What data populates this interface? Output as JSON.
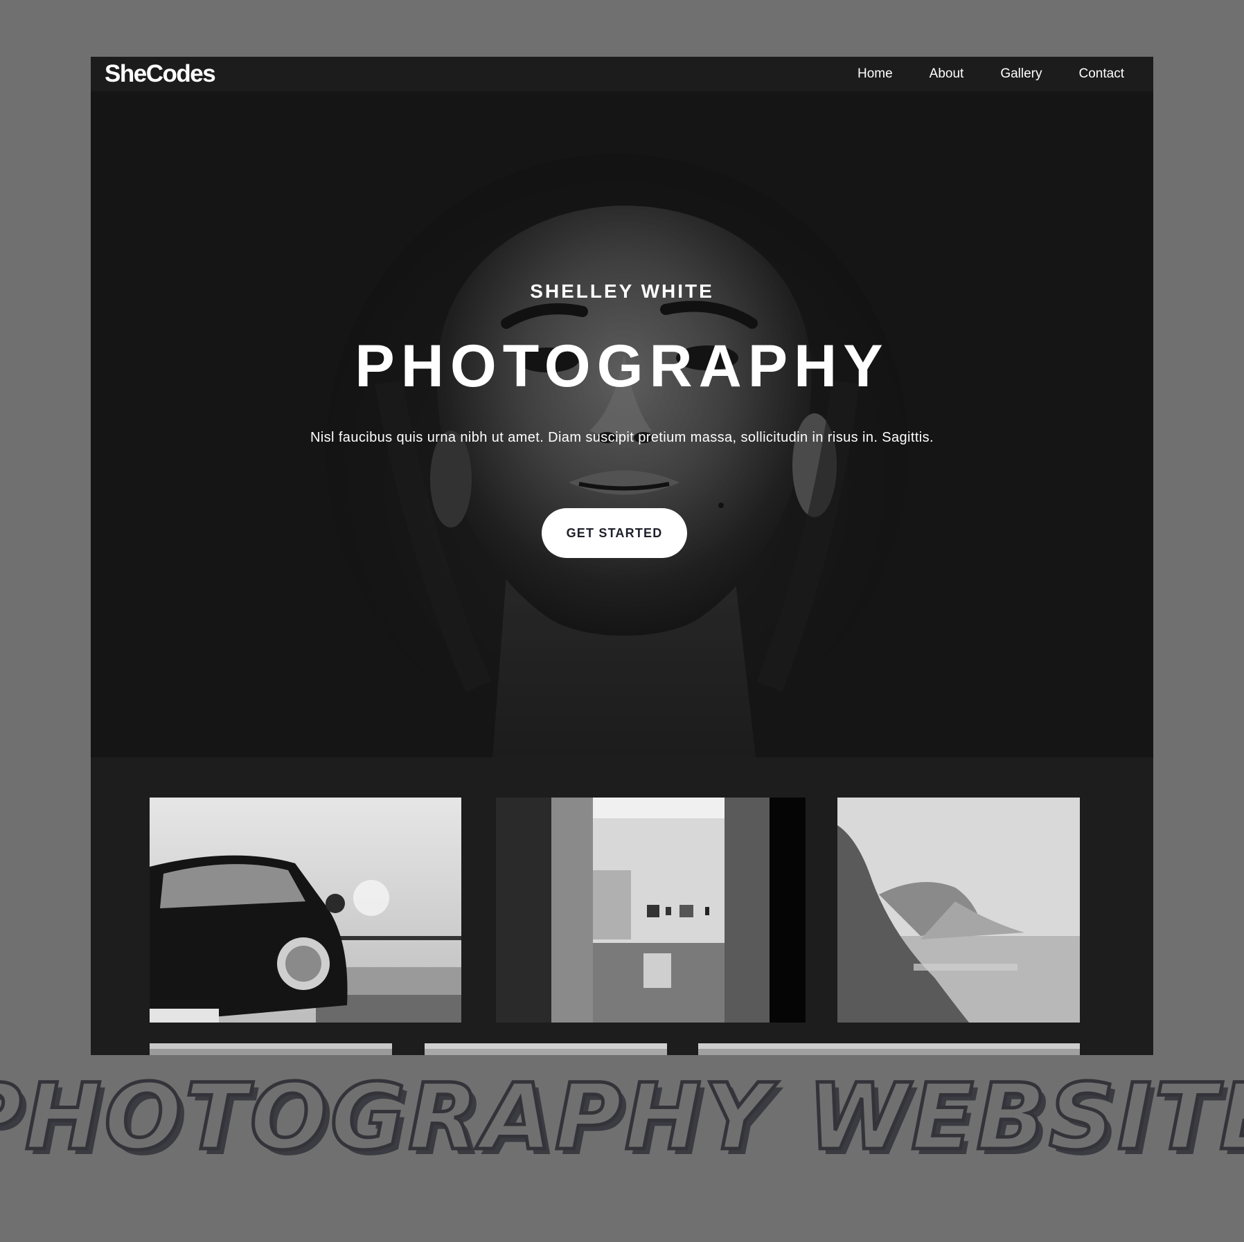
{
  "navbar": {
    "brand": "SheCodes",
    "links": [
      "Home",
      "About",
      "Gallery",
      "Contact"
    ]
  },
  "hero": {
    "subtitle": "SHELLEY WHITE",
    "title": "PHOTOGRAPHY",
    "text": "Nisl faucibus quis urna nibh ut amet. Diam suscipit pretium massa, sollicitudin in risus in. Sagittis.",
    "cta_label": "GET STARTED"
  },
  "gallery": {
    "photos": [
      "car",
      "gallery-interior",
      "coastal-cliff",
      "landscape",
      "landscape",
      "landscape"
    ]
  },
  "caption": {
    "text": "PHOTOGRAPHY WEBSITE"
  },
  "colors": {
    "page_background": "#707070",
    "site_background": "#1d1d1d",
    "button_background": "#ffffff",
    "button_text": "#1f1f2b",
    "caption_outline": "#333339"
  }
}
